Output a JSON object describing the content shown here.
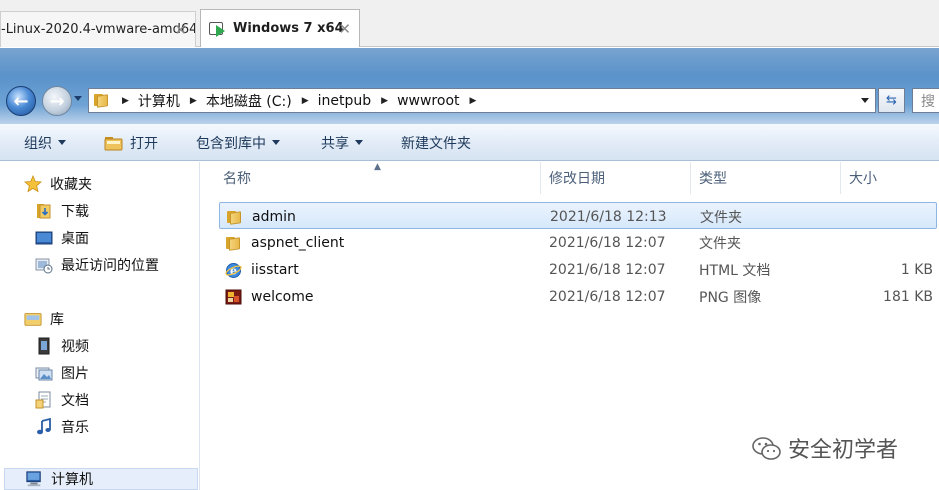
{
  "vm_tabs": [
    {
      "label": "-Linux-2020.4-vmware-amd64",
      "active": false
    },
    {
      "label": "Windows 7 x64",
      "active": true
    }
  ],
  "tab_close_glyph": "✕",
  "address": {
    "crumbs": [
      "计算机",
      "本地磁盘 (C:)",
      "inetpub",
      "wwwroot"
    ],
    "search_placeholder": "搜"
  },
  "toolbar": {
    "organize": "组织",
    "open": "打开",
    "include_library": "包含到库中",
    "share": "共享",
    "new_folder": "新建文件夹"
  },
  "sidebar": {
    "favorites": {
      "label": "收藏夹",
      "items": [
        "下载",
        "桌面",
        "最近访问的位置"
      ]
    },
    "libraries": {
      "label": "库",
      "items": [
        "视频",
        "图片",
        "文档",
        "音乐"
      ]
    },
    "computer": {
      "label": "计算机"
    }
  },
  "columns": {
    "name": "名称",
    "date": "修改日期",
    "type": "类型",
    "size": "大小"
  },
  "files": [
    {
      "name": "admin",
      "date": "2021/6/18 12:13",
      "type": "文件夹",
      "size": "",
      "icon": "folder-icon",
      "selected": true
    },
    {
      "name": "aspnet_client",
      "date": "2021/6/18 12:07",
      "type": "文件夹",
      "size": "",
      "icon": "folder-icon",
      "selected": false
    },
    {
      "name": "iisstart",
      "date": "2021/6/18 12:07",
      "type": "HTML 文档",
      "size": "1 KB",
      "icon": "ie-html-icon",
      "selected": false
    },
    {
      "name": "welcome",
      "date": "2021/6/18 12:07",
      "type": "PNG 图像",
      "size": "181 KB",
      "icon": "png-image-icon",
      "selected": false
    }
  ],
  "watermark": "安全初学者",
  "colors": {
    "accent": "#4d86c1",
    "selection": "#d6e8fb",
    "folder": "#e8b84a"
  }
}
